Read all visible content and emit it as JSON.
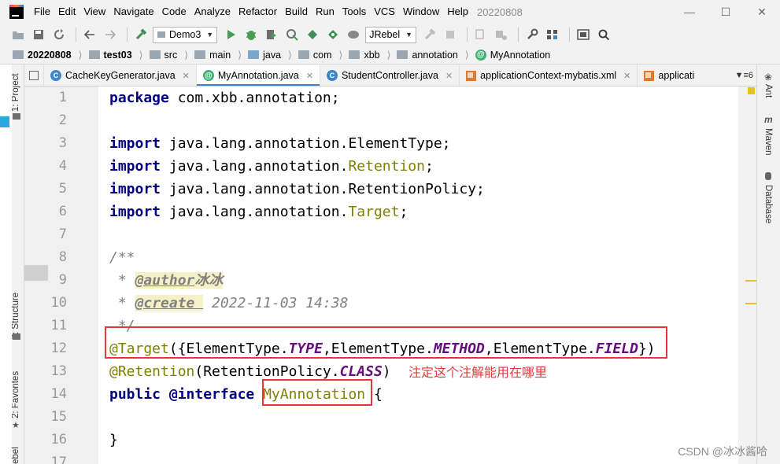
{
  "menubar": {
    "items": [
      "File",
      "Edit",
      "View",
      "Navigate",
      "Code",
      "Analyze",
      "Refactor",
      "Build",
      "Run",
      "Tools",
      "VCS",
      "Window",
      "Help"
    ],
    "project_title": "20220808"
  },
  "toolbar": {
    "run_config": "Demo3",
    "jrebel": "JRebel"
  },
  "breadcrumb": [
    "20220808",
    "test03",
    "src",
    "main",
    "java",
    "com",
    "xbb",
    "annotation",
    "MyAnnotation"
  ],
  "tabs": [
    {
      "label": "CacheKeyGenerator.java",
      "icon": "class-icon"
    },
    {
      "label": "MyAnnotation.java",
      "icon": "annotation-icon",
      "active": true
    },
    {
      "label": "StudentController.java",
      "icon": "class-icon"
    },
    {
      "label": "applicationContext-mybatis.xml",
      "icon": "xml-icon"
    },
    {
      "label": "applicati",
      "icon": "xml-icon"
    }
  ],
  "tabs_overflow": "6",
  "left_tools": [
    "1: Project",
    "Z: Structure",
    "2: Favorites",
    "ebel"
  ],
  "right_tools": [
    "Ant",
    "Maven",
    "Database"
  ],
  "code": {
    "line_numbers": [
      "1",
      "2",
      "3",
      "4",
      "5",
      "6",
      "7",
      "8",
      "9",
      "10",
      "11",
      "12",
      "13",
      "14",
      "15",
      "16",
      "17"
    ],
    "l1_kw": "package",
    "l1_rest": " com.xbb.annotation;",
    "l3_kw": "import",
    "l3_rest": " java.lang.annotation.ElementType;",
    "l4_kw": "import",
    "l4_a": " java.lang.annotation.",
    "l4_cls": "Retention",
    "l4_b": ";",
    "l5_kw": "import",
    "l5_rest": " java.lang.annotation.RetentionPolicy;",
    "l6_kw": "import",
    "l6_a": " java.lang.annotation.",
    "l6_cls": "Target",
    "l6_b": ";",
    "l8": "/**",
    "l9_star": " * ",
    "l9_tag": "@author",
    "l9_val": "冰冰",
    "l10_star": " * ",
    "l10_tag": "@create ",
    "l10_val": " 2022-11-03 14:38",
    "l11": " */",
    "l12_ann": "@Target",
    "l12_a": "({ElementType.",
    "l12_c1": "TYPE",
    "l12_b": ",ElementType.",
    "l12_c2": "METHOD",
    "l12_c": ",ElementType.",
    "l12_c3": "FIELD",
    "l12_d": "})",
    "l13_ann": "@Retention",
    "l13_a": "(RetentionPolicy.",
    "l13_c1": "CLASS",
    "l13_b": ")",
    "l14_kw1": "public",
    "l14_kw2": " @interface",
    "l14_name": "MyAnnotation",
    "l14_b": " {",
    "l16": "}"
  },
  "note": "注定这个注解能用在哪里",
  "watermark": "CSDN @冰冰酱哈"
}
